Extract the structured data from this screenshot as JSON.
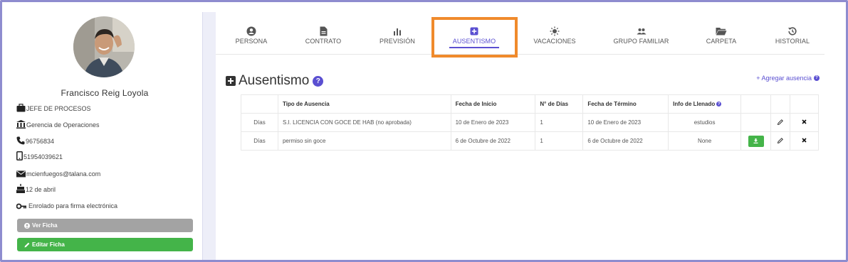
{
  "profile": {
    "name": "Francisco Reig Loyola",
    "cargo": "JEFE DE PROCESOS",
    "gerencia": "Gerencia de Operaciones",
    "phone": "96756834",
    "mobile": "51954039621",
    "email": "mcienfuegos@talana.com",
    "birthday": "12 de abril",
    "firma": "Enrolado para firma electrónica",
    "ver_ficha": "Ver Ficha",
    "editar_ficha": "Editar Ficha"
  },
  "tabs": [
    {
      "label": "PERSONA",
      "icon": "person-icon"
    },
    {
      "label": "CONTRATO",
      "icon": "document-icon"
    },
    {
      "label": "PREVISIÓN",
      "icon": "bar-chart-icon"
    },
    {
      "label": "AUSENTISMO",
      "icon": "plus-square-icon",
      "active": true
    },
    {
      "label": "VACACIONES",
      "icon": "sun-icon"
    },
    {
      "label": "GRUPO FAMILIAR",
      "icon": "users-icon"
    },
    {
      "label": "CARPETA",
      "icon": "folder-icon"
    },
    {
      "label": "HISTORIAL",
      "icon": "history-icon"
    }
  ],
  "section": {
    "title": "Ausentismo",
    "add_label": "+ Agregar ausencia"
  },
  "table": {
    "headers": [
      "",
      "Tipo de Ausencia",
      "Fecha de Inicio",
      "N° de Días",
      "Fecha de Término",
      "Info de Llenado",
      "",
      "",
      ""
    ],
    "rows": [
      {
        "unit": "Días",
        "tipo": "S.I. LICENCIA CON GOCE DE HAB (no aprobada)",
        "inicio": "10 de Enero de 2023",
        "dias": "1",
        "termino": "10 de Enero de 2023",
        "info": "estudios",
        "download": false
      },
      {
        "unit": "Días",
        "tipo": "permiso sin goce",
        "inicio": "6 de Octubre de 2022",
        "dias": "1",
        "termino": "6 de Octubre de 2022",
        "info": "None",
        "download": true
      }
    ]
  },
  "colors": {
    "accent": "#5a4fd1",
    "green": "#44b449",
    "grey_button": "#a3a3a3",
    "highlight": "#f08a2c"
  }
}
